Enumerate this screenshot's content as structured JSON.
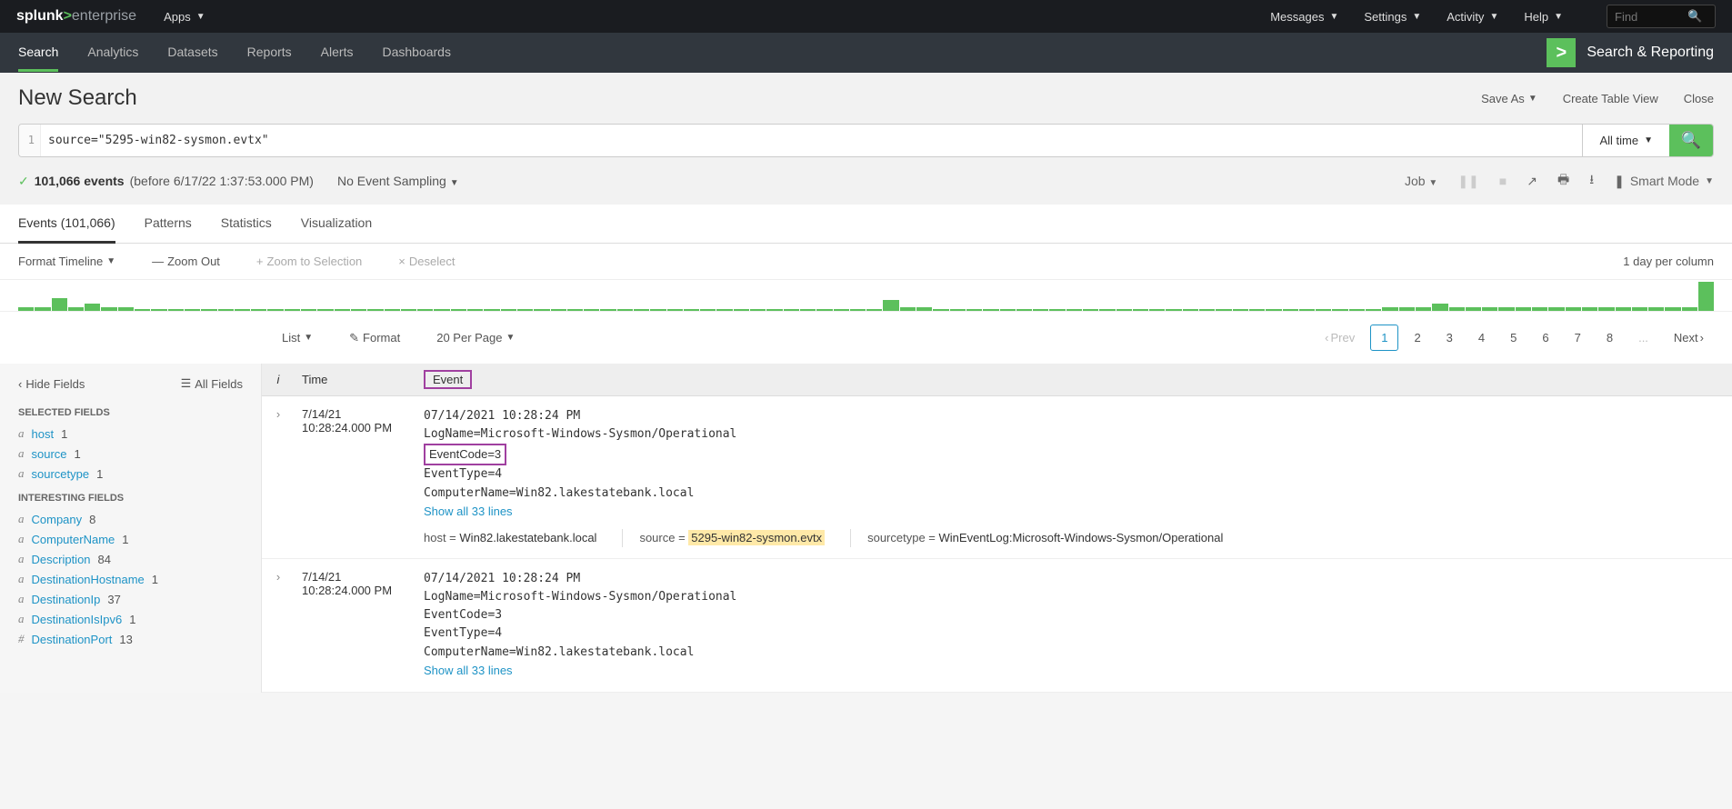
{
  "topbar": {
    "apps_label": "Apps",
    "find_placeholder": "Find",
    "menus": {
      "messages": "Messages",
      "settings": "Settings",
      "activity": "Activity",
      "help": "Help"
    }
  },
  "appnav": {
    "items": [
      "Search",
      "Analytics",
      "Datasets",
      "Reports",
      "Alerts",
      "Dashboards"
    ],
    "active": "Search",
    "app_title": "Search & Reporting"
  },
  "title": "New Search",
  "title_actions": {
    "save_as": "Save As",
    "create_table": "Create Table View",
    "close": "Close"
  },
  "search": {
    "line": "1",
    "query": "source=\"5295-win82-sysmon.evtx\"",
    "timerange": "All time"
  },
  "status": {
    "event_count": "101,066 events",
    "meta": "(before 6/17/22 1:37:53.000 PM)",
    "sampling": "No Event Sampling",
    "job": "Job",
    "mode": "Smart Mode"
  },
  "tabs": {
    "events": "Events (101,066)",
    "patterns": "Patterns",
    "statistics": "Statistics",
    "visualization": "Visualization"
  },
  "timeline_ctrl": {
    "format": "Format Timeline",
    "zoom_out": "Zoom Out",
    "zoom_sel": "Zoom to Selection",
    "deselect": "Deselect",
    "info": "1 day per column"
  },
  "list_ctrl": {
    "list": "List",
    "format": "Format",
    "perpage": "20 Per Page"
  },
  "pagination": {
    "prev": "Prev",
    "next": "Next",
    "pages": [
      "1",
      "2",
      "3",
      "4",
      "5",
      "6",
      "7",
      "8"
    ],
    "ellipsis": "..."
  },
  "fields": {
    "hide": "Hide Fields",
    "all": "All Fields",
    "selected_hdr": "SELECTED FIELDS",
    "interesting_hdr": "INTERESTING FIELDS",
    "selected": [
      {
        "t": "a",
        "name": "host",
        "count": "1"
      },
      {
        "t": "a",
        "name": "source",
        "count": "1"
      },
      {
        "t": "a",
        "name": "sourcetype",
        "count": "1"
      }
    ],
    "interesting": [
      {
        "t": "a",
        "name": "Company",
        "count": "8"
      },
      {
        "t": "a",
        "name": "ComputerName",
        "count": "1"
      },
      {
        "t": "a",
        "name": "Description",
        "count": "84"
      },
      {
        "t": "a",
        "name": "DestinationHostname",
        "count": "1"
      },
      {
        "t": "a",
        "name": "DestinationIp",
        "count": "37"
      },
      {
        "t": "a",
        "name": "DestinationIsIpv6",
        "count": "1"
      },
      {
        "t": "#",
        "name": "DestinationPort",
        "count": "13"
      }
    ]
  },
  "event_headers": {
    "i": "i",
    "time": "Time",
    "event": "Event"
  },
  "events": [
    {
      "date": "7/14/21",
      "time": "10:28:24.000 PM",
      "lines": [
        "07/14/2021 10:28:24 PM",
        "LogName=Microsoft-Windows-Sysmon/Operational",
        "EventCode=3",
        "EventType=4",
        "ComputerName=Win82.lakestatebank.local"
      ],
      "showall": "Show all 33 lines",
      "meta": {
        "host_k": "host =",
        "host_v": "Win82.lakestatebank.local",
        "source_k": "source =",
        "source_v": "5295-win82-sysmon.evtx",
        "stype_k": "sourcetype =",
        "stype_v": "WinEventLog:Microsoft-Windows-Sysmon/Operational"
      },
      "highlight_eventcode": true
    },
    {
      "date": "7/14/21",
      "time": "10:28:24.000 PM",
      "lines": [
        "07/14/2021 10:28:24 PM",
        "LogName=Microsoft-Windows-Sysmon/Operational",
        "EventCode=3",
        "EventType=4",
        "ComputerName=Win82.lakestatebank.local"
      ],
      "showall": "Show all 33 lines"
    }
  ]
}
